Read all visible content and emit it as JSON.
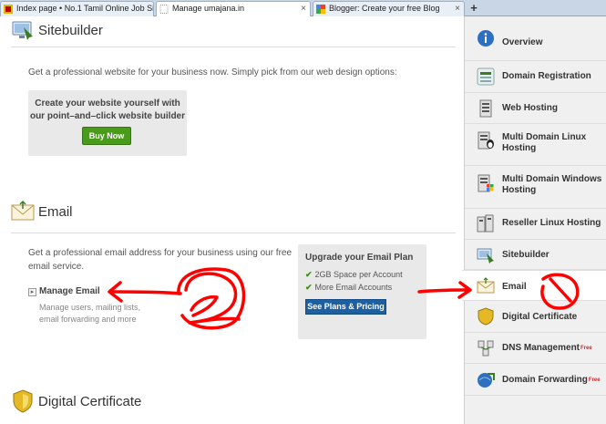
{
  "browser": {
    "tabs": [
      {
        "label": "Index page • No.1 Tamil Online Job Site -...",
        "active": false
      },
      {
        "label": "Manage umajana.in",
        "active": true
      },
      {
        "label": "Blogger: Create your free Blog",
        "active": false
      }
    ],
    "close_glyph": "×",
    "new_tab_glyph": "+"
  },
  "sitebuilder": {
    "title": "Sitebuilder",
    "description": "Get a professional website for your business now. Simply pick from our web design options:",
    "builder_line1": "Create your website yourself with",
    "builder_line2": "our point–and–click website builder",
    "buy_now": "Buy Now"
  },
  "email": {
    "title": "Email",
    "description_line1": "Get a professional email address for your business using our free",
    "description_line2": "email service.",
    "manage_email": "Manage Email",
    "manage_desc_line1": "Manage users, mailing lists,",
    "manage_desc_line2": "email forwarding and more",
    "upgrade_title": "Upgrade your Email Plan",
    "features": [
      "2GB Space per Account",
      "More Email Accounts"
    ],
    "plans_button": "See Plans & Pricing"
  },
  "digital_certificate": {
    "title": "Digital Certificate"
  },
  "sidebar": {
    "items": [
      {
        "label": "Overview",
        "icon": "info-icon"
      },
      {
        "label": "Domain Registration",
        "icon": "domain-icon"
      },
      {
        "label": "Web Hosting",
        "icon": "server-icon"
      },
      {
        "label": "Multi Domain Linux Hosting",
        "icon": "linux-server-icon"
      },
      {
        "label": "Multi Domain Windows Hosting",
        "icon": "windows-server-icon"
      },
      {
        "label": "Reseller Linux Hosting",
        "icon": "reseller-server-icon"
      },
      {
        "label": "Sitebuilder",
        "icon": "sitebuilder-icon"
      },
      {
        "label": "Email",
        "icon": "envelope-icon",
        "active": true
      },
      {
        "label": "Digital Certificate",
        "icon": "shield-icon"
      },
      {
        "label": "DNS Management",
        "icon": "dns-icon",
        "badge": "Free"
      },
      {
        "label": "Domain Forwarding",
        "icon": "forward-icon",
        "badge": "Free"
      }
    ]
  },
  "colors": {
    "annotation": "#ff0000",
    "buy_now": "#4a9a1c",
    "plans_button": "#1d5fa3"
  }
}
